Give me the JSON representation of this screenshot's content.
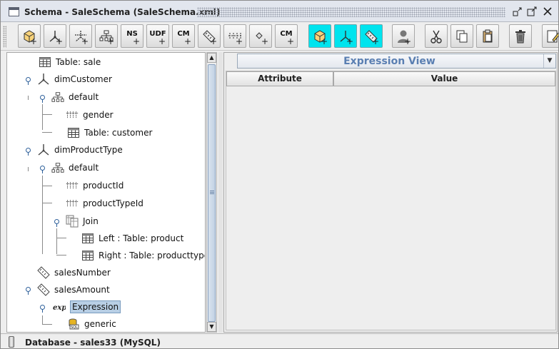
{
  "window": {
    "title": "Schema - SaleSchema (SaleSchema.xml)",
    "buttons": [
      "minimize",
      "maximize",
      "close"
    ]
  },
  "toolbar": {
    "buttons": [
      {
        "name": "add-cube-button",
        "icon": "cube-icon",
        "text": "",
        "highlighted": false
      },
      {
        "name": "add-dimension-button",
        "icon": "dimension-icon",
        "text": "",
        "highlighted": false
      },
      {
        "name": "add-dimension-usage-button",
        "icon": "dimension-usage-icon",
        "text": "",
        "highlighted": false
      },
      {
        "name": "add-hierarchy-button",
        "icon": "hierarchy-icon",
        "text": "",
        "highlighted": false
      },
      {
        "name": "add-named-set-button",
        "icon": "ns-icon",
        "text": "NS",
        "highlighted": false
      },
      {
        "name": "add-udf-button",
        "icon": "udf-icon",
        "text": "UDF",
        "highlighted": false
      },
      {
        "name": "add-calculated-member-button",
        "icon": "cm-icon",
        "text": "CM",
        "highlighted": false
      },
      {
        "name": "add-measure-button",
        "icon": "measure-icon",
        "text": "",
        "highlighted": false
      },
      {
        "name": "add-level-button",
        "icon": "level-icon",
        "text": "",
        "highlighted": false
      },
      {
        "name": "add-property-button",
        "icon": "property-icon",
        "text": "",
        "highlighted": false
      },
      {
        "name": "add-calculated-member-property-button",
        "icon": "cm-property-icon",
        "text": "CM",
        "highlighted": false
      },
      {
        "name": "add-virtual-cube-button",
        "icon": "virtual-cube-icon",
        "text": "",
        "highlighted": true
      },
      {
        "name": "add-virtual-dimension-button",
        "icon": "virtual-dimension-icon",
        "text": "",
        "highlighted": true
      },
      {
        "name": "add-virtual-measure-button",
        "icon": "virtual-measure-icon",
        "text": "",
        "highlighted": true
      },
      {
        "name": "add-role-button",
        "icon": "role-icon",
        "text": "",
        "highlighted": false
      },
      {
        "name": "cut-button",
        "icon": "scissors-icon",
        "text": "",
        "highlighted": false
      },
      {
        "name": "copy-button",
        "icon": "copy-icon",
        "text": "",
        "highlighted": false
      },
      {
        "name": "paste-button",
        "icon": "paste-icon",
        "text": "",
        "highlighted": false
      },
      {
        "name": "delete-button",
        "icon": "trash-icon",
        "text": "",
        "highlighted": false
      },
      {
        "name": "edit-button",
        "icon": "edit-icon",
        "text": "",
        "highlighted": false
      }
    ]
  },
  "tree": {
    "nodes": [
      {
        "label": "Table: sale",
        "icon": "table-icon",
        "depth": 1,
        "selected": false
      },
      {
        "label": "dimCustomer",
        "icon": "dimension-icon",
        "depth": 0,
        "selected": false
      },
      {
        "label": "default",
        "icon": "hierarchy-icon",
        "depth": 1,
        "selected": false
      },
      {
        "label": "gender",
        "icon": "level-icon",
        "depth": 2,
        "selected": false
      },
      {
        "label": "Table: customer",
        "icon": "table-icon",
        "depth": 2,
        "selected": false
      },
      {
        "label": "dimProductType",
        "icon": "dimension-icon",
        "depth": 0,
        "selected": false
      },
      {
        "label": "default",
        "icon": "hierarchy-icon",
        "depth": 1,
        "selected": false
      },
      {
        "label": "productId",
        "icon": "level-icon",
        "depth": 2,
        "selected": false
      },
      {
        "label": "productTypeId",
        "icon": "level-icon",
        "depth": 2,
        "selected": false
      },
      {
        "label": "Join",
        "icon": "join-icon",
        "depth": 2,
        "selected": false
      },
      {
        "label": "Left  : Table: product",
        "icon": "table-icon",
        "depth": 3,
        "selected": false
      },
      {
        "label": "Right  : Table: producttype",
        "icon": "table-icon",
        "depth": 3,
        "selected": false
      },
      {
        "label": "salesNumber",
        "icon": "measure-icon",
        "depth": 0,
        "selected": false
      },
      {
        "label": "salesAmount",
        "icon": "measure-icon",
        "depth": 0,
        "selected": false
      },
      {
        "label": "Expression",
        "icon": "expression-icon",
        "depth": 1,
        "selected": true
      },
      {
        "label": "generic",
        "icon": "sql-icon",
        "depth": 2,
        "selected": false
      }
    ]
  },
  "right_panel": {
    "view_title": "Expression View",
    "columns": [
      "Attribute",
      "Value"
    ]
  },
  "status": {
    "text": "Database - sales33 (MySQL)"
  },
  "colors": {
    "highlight_button": "#00e4ee",
    "selection": "#b8cfe5",
    "view_title": "#5a7fb2"
  }
}
